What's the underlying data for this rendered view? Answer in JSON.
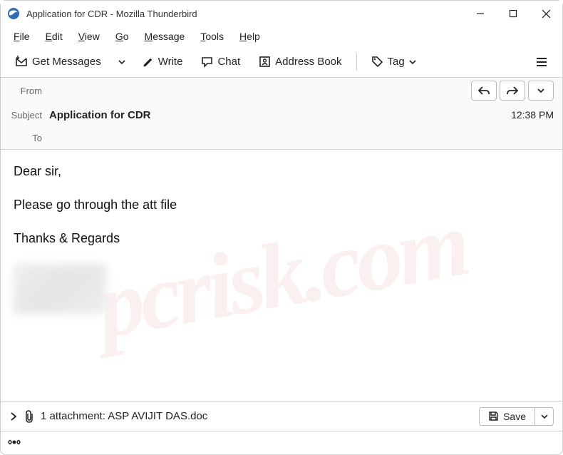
{
  "window": {
    "title": "Application for CDR - Mozilla Thunderbird"
  },
  "menu": {
    "file": "File",
    "edit": "Edit",
    "view": "View",
    "go": "Go",
    "message": "Message",
    "tools": "Tools",
    "help": "Help"
  },
  "toolbar": {
    "get_messages": "Get Messages",
    "write": "Write",
    "chat": "Chat",
    "address_book": "Address Book",
    "tag": "Tag"
  },
  "headers": {
    "from_label": "From",
    "from_value": "",
    "subject_label": "Subject",
    "subject_value": "Application for CDR",
    "time": "12:38 PM",
    "to_label": "To",
    "to_value": ""
  },
  "body": {
    "line1": "Dear sir,",
    "line2": "Please go through the att file",
    "line3": "Thanks & Regards"
  },
  "attachment": {
    "text": "1 attachment: ASP AVIJIT DAS.doc",
    "save": "Save"
  },
  "watermark": "pcrisk.com"
}
